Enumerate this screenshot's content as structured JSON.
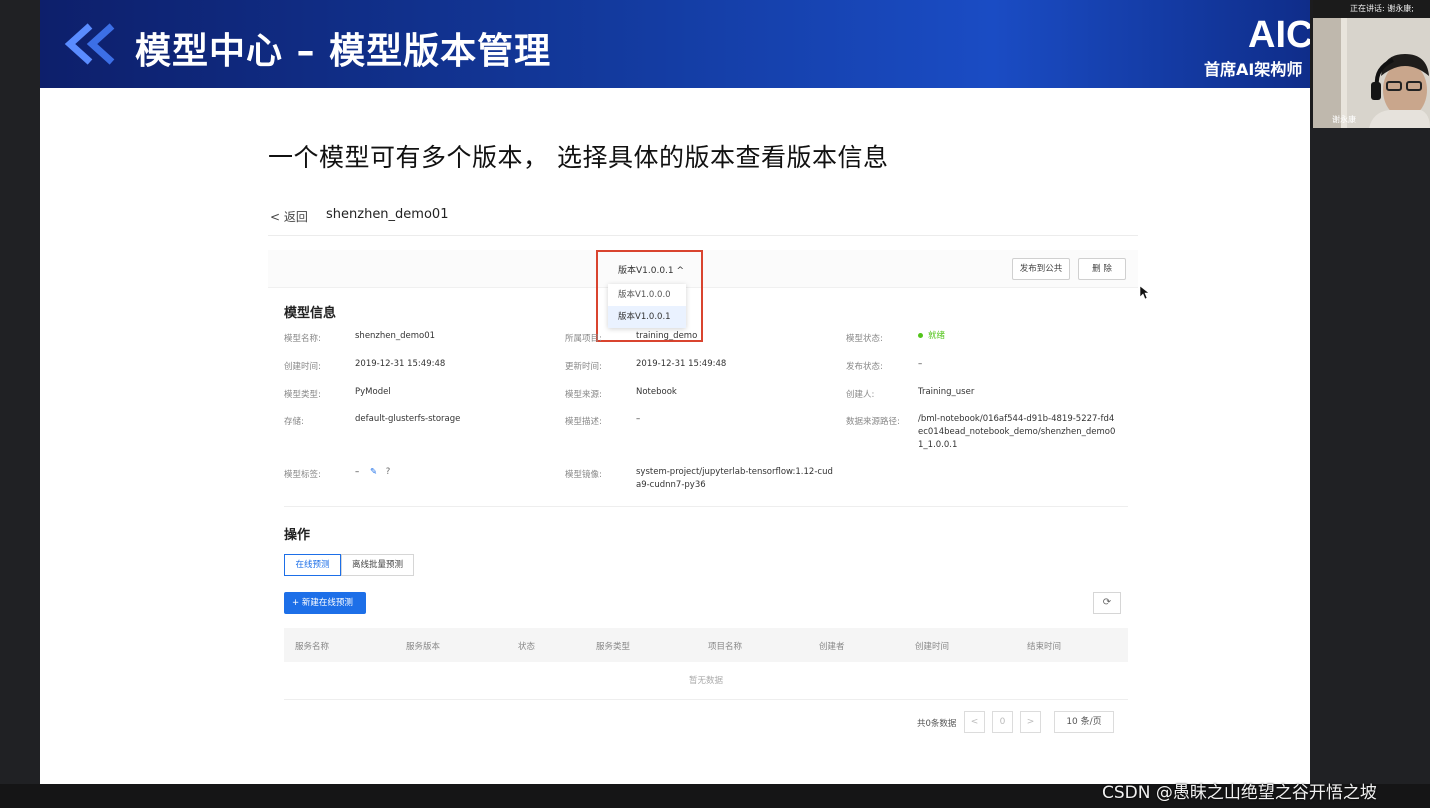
{
  "slide": {
    "banner_title": "模型中心 – 模型版本管理",
    "logo": "AIC",
    "logo_sub": "首席AI架构师",
    "headline": "一个模型可有多个版本， 选择具体的版本查看版本信息"
  },
  "app": {
    "back_label": "返回",
    "model_name": "shenzhen_demo01",
    "version_selected": "版本V1.0.0.1",
    "version_options": [
      "版本V1.0.0.0",
      "版本V1.0.0.1"
    ],
    "publish_button": "发布到公共",
    "delete_button": "删 除",
    "info_title": "模型信息",
    "fields": {
      "name_label": "模型名称:",
      "name_value": "shenzhen_demo01",
      "project_label": "所属项目:",
      "project_value": "training_demo",
      "status_label": "模型状态:",
      "status_value": "就绪",
      "created_label": "创建时间:",
      "created_value": "2019-12-31 15:49:48",
      "updated_label": "更新时间:",
      "updated_value": "2019-12-31 15:49:48",
      "publish_status_label": "发布状态:",
      "publish_status_value": "–",
      "type_label": "模型类型:",
      "type_value": "PyModel",
      "source_label": "模型来源:",
      "source_value": "Notebook",
      "creator_label": "创建人:",
      "creator_value": "Training_user",
      "storage_label": "存储:",
      "storage_value": "default-glusterfs-storage",
      "desc_label": "模型描述:",
      "desc_value": "–",
      "datapath_label": "数据来源路径:",
      "datapath_value": "/bml-notebook/016af544-d91b-4819-5227-fd4ec014bead_notebook_demo/shenzhen_demo01_1.0.0.1",
      "tags_label": "模型标签:",
      "tags_value": "–",
      "image_label": "模型镜像:",
      "image_value": "system-project/jupyterlab-tensorflow:1.12-cuda9-cudnn7-py36"
    },
    "ops_title": "操作",
    "tabs": [
      "在线预测",
      "离线批量预测"
    ],
    "new_button": "新建在线预测",
    "table_headers": [
      "服务名称",
      "服务版本",
      "状态",
      "服务类型",
      "项目名称",
      "创建者",
      "创建时间",
      "结束时间"
    ],
    "empty_text": "暂无数据",
    "pagination": {
      "total": "共0条数据",
      "page": "0",
      "page_size": "10 条/页"
    }
  },
  "webcam": {
    "status": "正在讲话: 谢永康;",
    "name": "谢永康"
  },
  "watermark": "CSDN @愚昧之山绝望之谷开悟之坡",
  "colors": {
    "accent": "#1d6fe8",
    "highlight_box": "#d9442f",
    "status_ready": "#52c41a",
    "banner": "#133a9e"
  }
}
